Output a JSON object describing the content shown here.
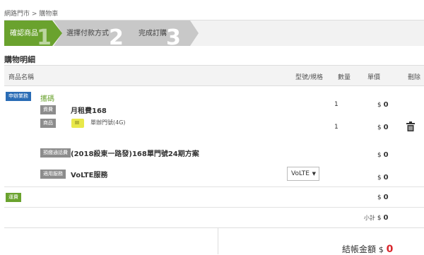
{
  "breadcrumb": "網路門市 > 購物車",
  "steps": [
    {
      "label": "確認商品",
      "number": "1"
    },
    {
      "label": "選擇付款方式",
      "number": "2"
    },
    {
      "label": "完成訂購",
      "number": "3"
    }
  ],
  "section_title": "購物明細",
  "columns": {
    "name": "商品名稱",
    "model": "型號/規格",
    "qty": "數量",
    "price": "單價",
    "delete": "刪除"
  },
  "order": {
    "type_badge": "申辦業務",
    "type_name": "攜碼",
    "items": [
      {
        "badge": "資費",
        "name": "月租費168",
        "qty": "1",
        "currency": "$",
        "price": "0"
      },
      {
        "badge": "商品",
        "name": "單辦門號(4G)",
        "qty": "1",
        "currency": "$",
        "price": "0"
      }
    ],
    "plan": {
      "badge": "預繳通話費",
      "name": "(2018殺東一路發)168單門號24期方案",
      "currency": "$",
      "price": "0"
    },
    "service": {
      "badge": "適用服務",
      "name": "VoLTE服務",
      "select_value": "VoLTE",
      "currency": "$",
      "price": "0"
    }
  },
  "shipping": {
    "badge": "運費",
    "currency": "$",
    "price": "0"
  },
  "subtotal": {
    "label": "小計",
    "currency": "$",
    "value": "0"
  },
  "total": {
    "label": "結帳金額",
    "currency": "$",
    "value": "0"
  },
  "colors": {
    "step_active": "#6aa22e",
    "step_inactive": "#c8c8c8",
    "total_value": "#d9262c",
    "badge_blue": "#2a6cb5"
  }
}
